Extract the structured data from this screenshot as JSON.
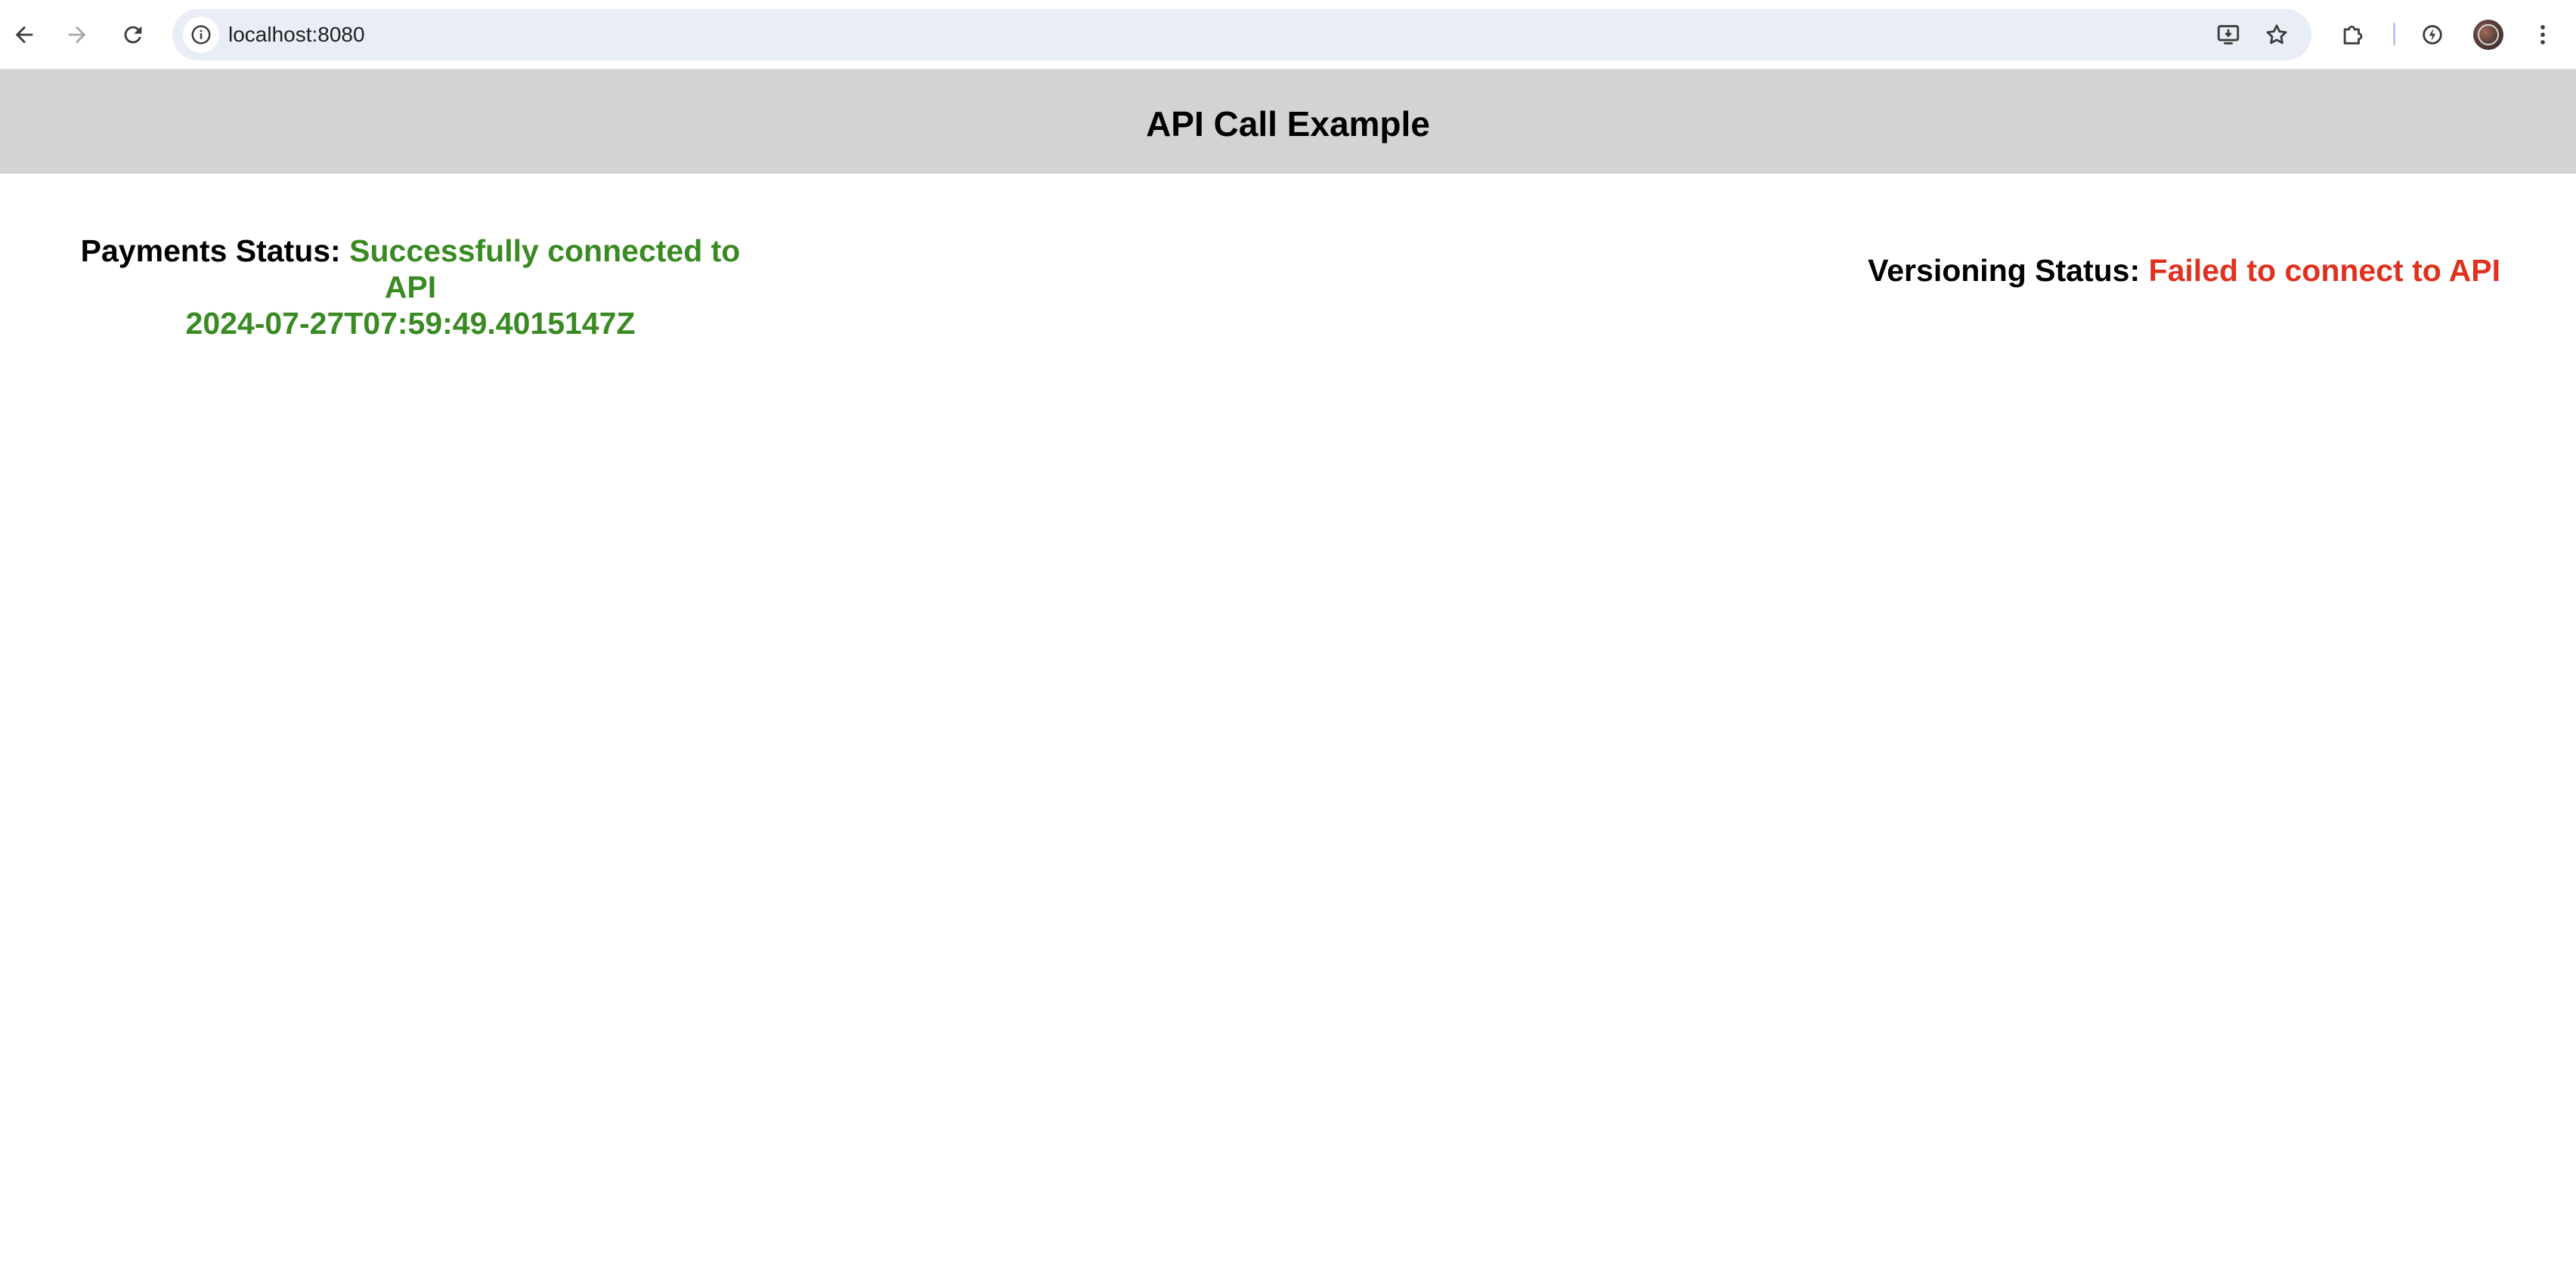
{
  "browser": {
    "url": "localhost:8080",
    "icons": {
      "back": "arrow-left-icon",
      "forward": "arrow-right-icon",
      "reload": "reload-icon",
      "site_info": "info-icon",
      "install": "install-app-icon",
      "bookmark": "star-icon",
      "extensions": "puzzle-icon",
      "performance": "speedometer-icon",
      "profile": "avatar",
      "menu": "kebab-menu-icon"
    }
  },
  "header": {
    "title": "API Call Example"
  },
  "payments": {
    "label": "Payments Status:",
    "message": "Successfully connected to API",
    "timestamp": "2024-07-27T07:59:49.4015147Z",
    "color": "#3a8a23"
  },
  "versioning": {
    "label": "Versioning Status:",
    "message": "Failed to connect to API",
    "color": "#e0311f"
  },
  "colors": {
    "header_bg": "#d3d3d3",
    "omnibox_bg": "#e9edf5"
  }
}
